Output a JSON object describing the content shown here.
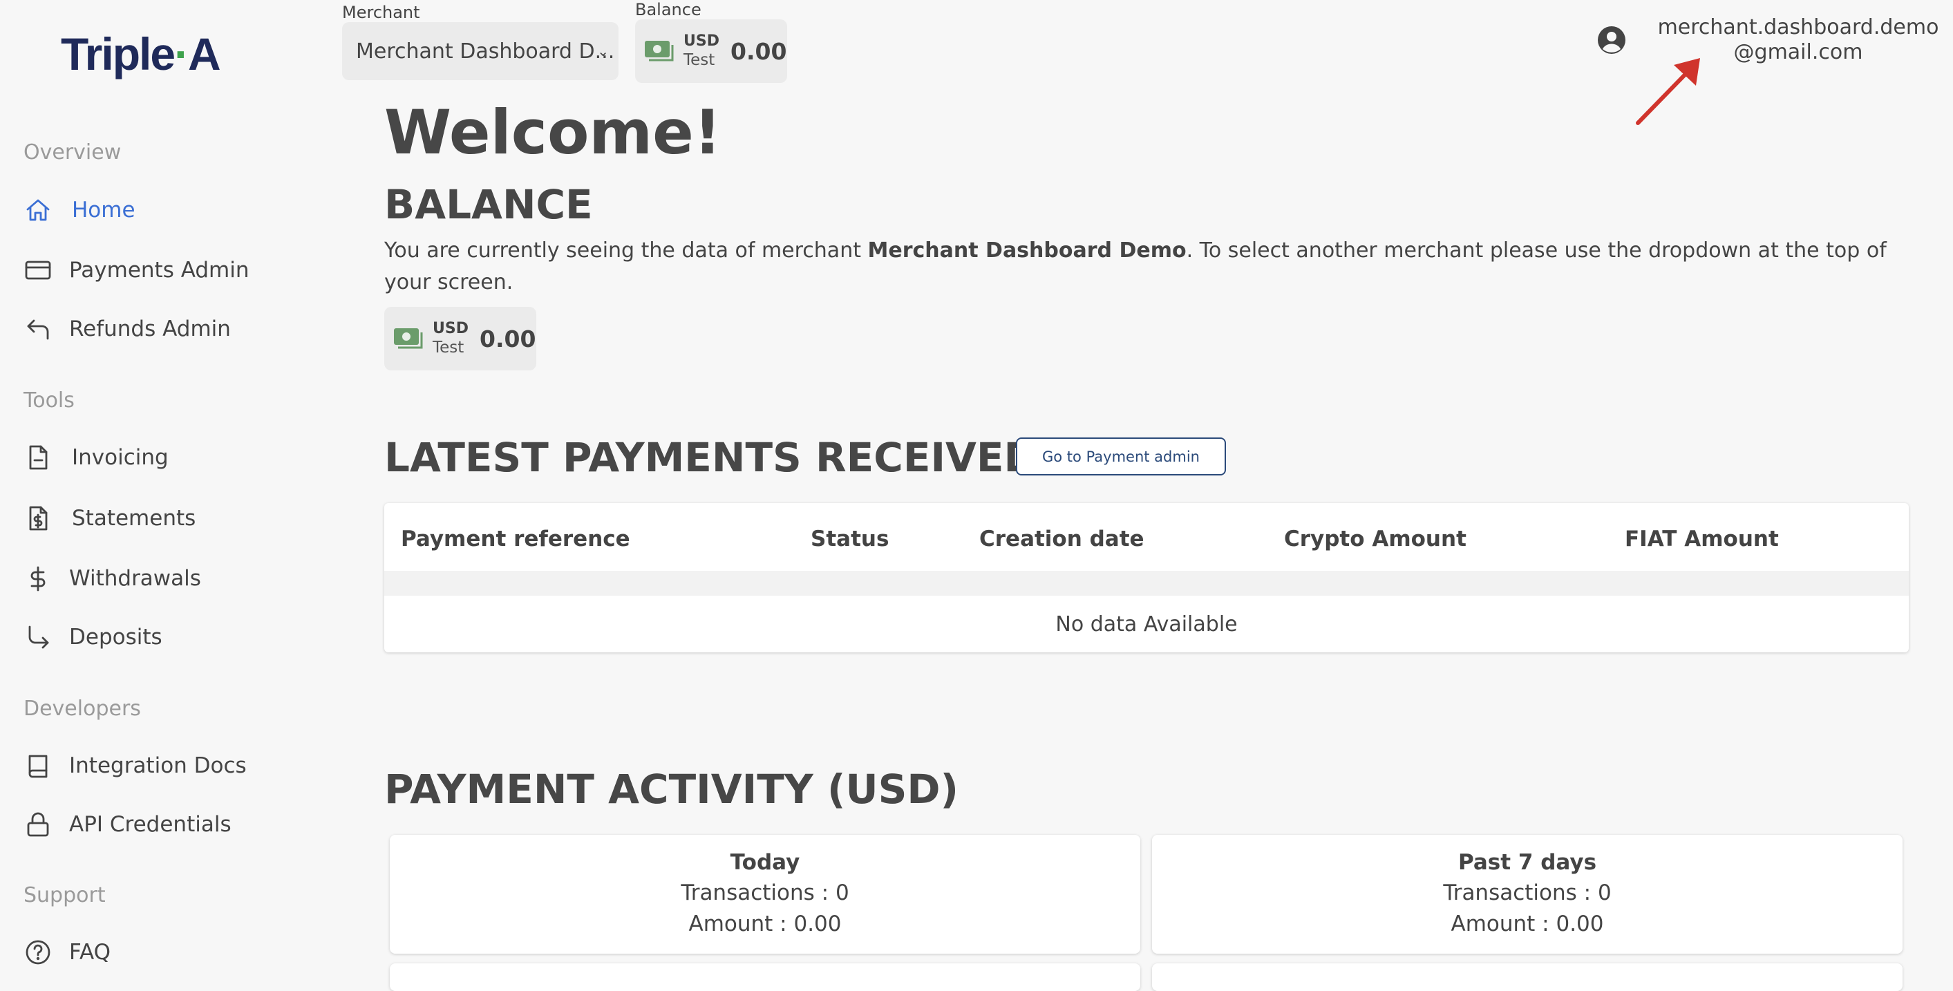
{
  "brand": {
    "logo_left": "Triple",
    "logo_dot": "·",
    "logo_right": "A"
  },
  "sidebar": {
    "sections": [
      {
        "title": "Overview"
      },
      {
        "title": "Tools"
      },
      {
        "title": "Developers"
      },
      {
        "title": "Support"
      }
    ],
    "items": [
      {
        "label": "Home",
        "icon": "home-icon",
        "active": true
      },
      {
        "label": "Payments Admin",
        "icon": "card-icon"
      },
      {
        "label": "Refunds Admin",
        "icon": "return-icon"
      },
      {
        "label": "Invoicing",
        "icon": "document-icon"
      },
      {
        "label": "Statements",
        "icon": "statement-icon"
      },
      {
        "label": "Withdrawals",
        "icon": "dollar-icon"
      },
      {
        "label": "Deposits",
        "icon": "deposit-arrow-icon"
      },
      {
        "label": "Integration Docs",
        "icon": "book-icon"
      },
      {
        "label": "API Credentials",
        "icon": "lock-icon"
      },
      {
        "label": "FAQ",
        "icon": "help-icon"
      }
    ],
    "active_color": "#3b6fd4"
  },
  "topbar": {
    "merchant_label": "Merchant",
    "merchant_value": "Merchant Dashboard D...",
    "balance_label": "Balance",
    "balance": {
      "currency": "USD",
      "mode": "Test",
      "amount": "0.00"
    }
  },
  "user": {
    "email": "merchant.dashboard.demo@gmail.com"
  },
  "main": {
    "welcome": "Welcome!",
    "balance_heading": "BALANCE",
    "desc_pre": "You are currently seeing the data of merchant ",
    "desc_merchant": "Merchant Dashboard Demo",
    "desc_post": ". To select another merchant please use the dropdown at the top of your screen.",
    "balance": {
      "currency": "USD",
      "mode": "Test",
      "amount": "0.00"
    },
    "latest_heading": "LATEST PAYMENTS RECEIVED",
    "go_button": "Go to Payment admin",
    "table": {
      "columns": [
        "Payment reference",
        "Status",
        "Creation date",
        "Crypto Amount",
        "FIAT Amount"
      ],
      "empty": "No data Available"
    },
    "activity_heading": "PAYMENT ACTIVITY (USD)",
    "activity": [
      {
        "title": "Today",
        "transactions": "Transactions : 0",
        "amount": "Amount : 0.00"
      },
      {
        "title": "Past 7 days",
        "transactions": "Transactions : 0",
        "amount": "Amount : 0.00"
      }
    ]
  },
  "colors": {
    "cash_icon": "#6b9c6b",
    "annotation_arrow": "#d0342c",
    "button_outline": "#2b4a7a"
  }
}
